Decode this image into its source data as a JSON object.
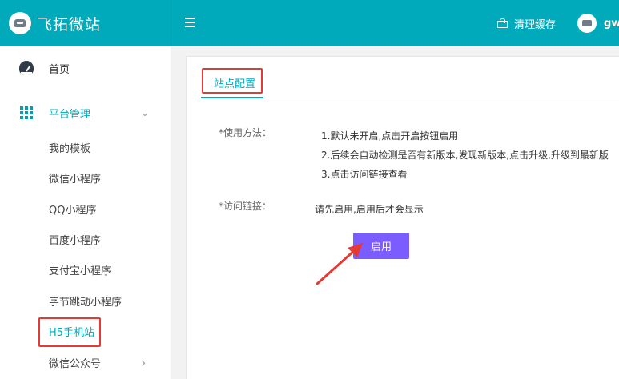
{
  "header": {
    "brand_title": "飞拓微站",
    "clear_cache_label": "清理缓存",
    "username": "gw"
  },
  "sidebar": {
    "items": [
      {
        "label": "首页",
        "icon": "dashboard-icon"
      },
      {
        "label": "平台管理",
        "icon": "grid-icon",
        "expanded": true
      },
      {
        "label": "我的模板"
      },
      {
        "label": "微信小程序"
      },
      {
        "label": "QQ小程序"
      },
      {
        "label": "百度小程序"
      },
      {
        "label": "支付宝小程序"
      },
      {
        "label": "字节跳动小程序"
      },
      {
        "label": "H5手机站",
        "active": true
      },
      {
        "label": "微信公众号",
        "has_submenu": true
      }
    ],
    "chevron_down": "⌄",
    "chevron_right": "›"
  },
  "main": {
    "tab_label": "站点配置",
    "usage_label": "*使用方法：",
    "usage_lines": [
      "1.默认未开启,点击开启按钮启用",
      "2.后续会自动检测是否有新版本,发现新版本,点击升级,升级到最新版",
      "3.点击访问链接查看"
    ],
    "link_label": "*访问链接：",
    "link_value": "请先启用,启用后才会显示",
    "enable_button": "启用"
  },
  "colors": {
    "accent": "#00aabb",
    "button": "#7a5cff",
    "highlight": "#e53935"
  }
}
